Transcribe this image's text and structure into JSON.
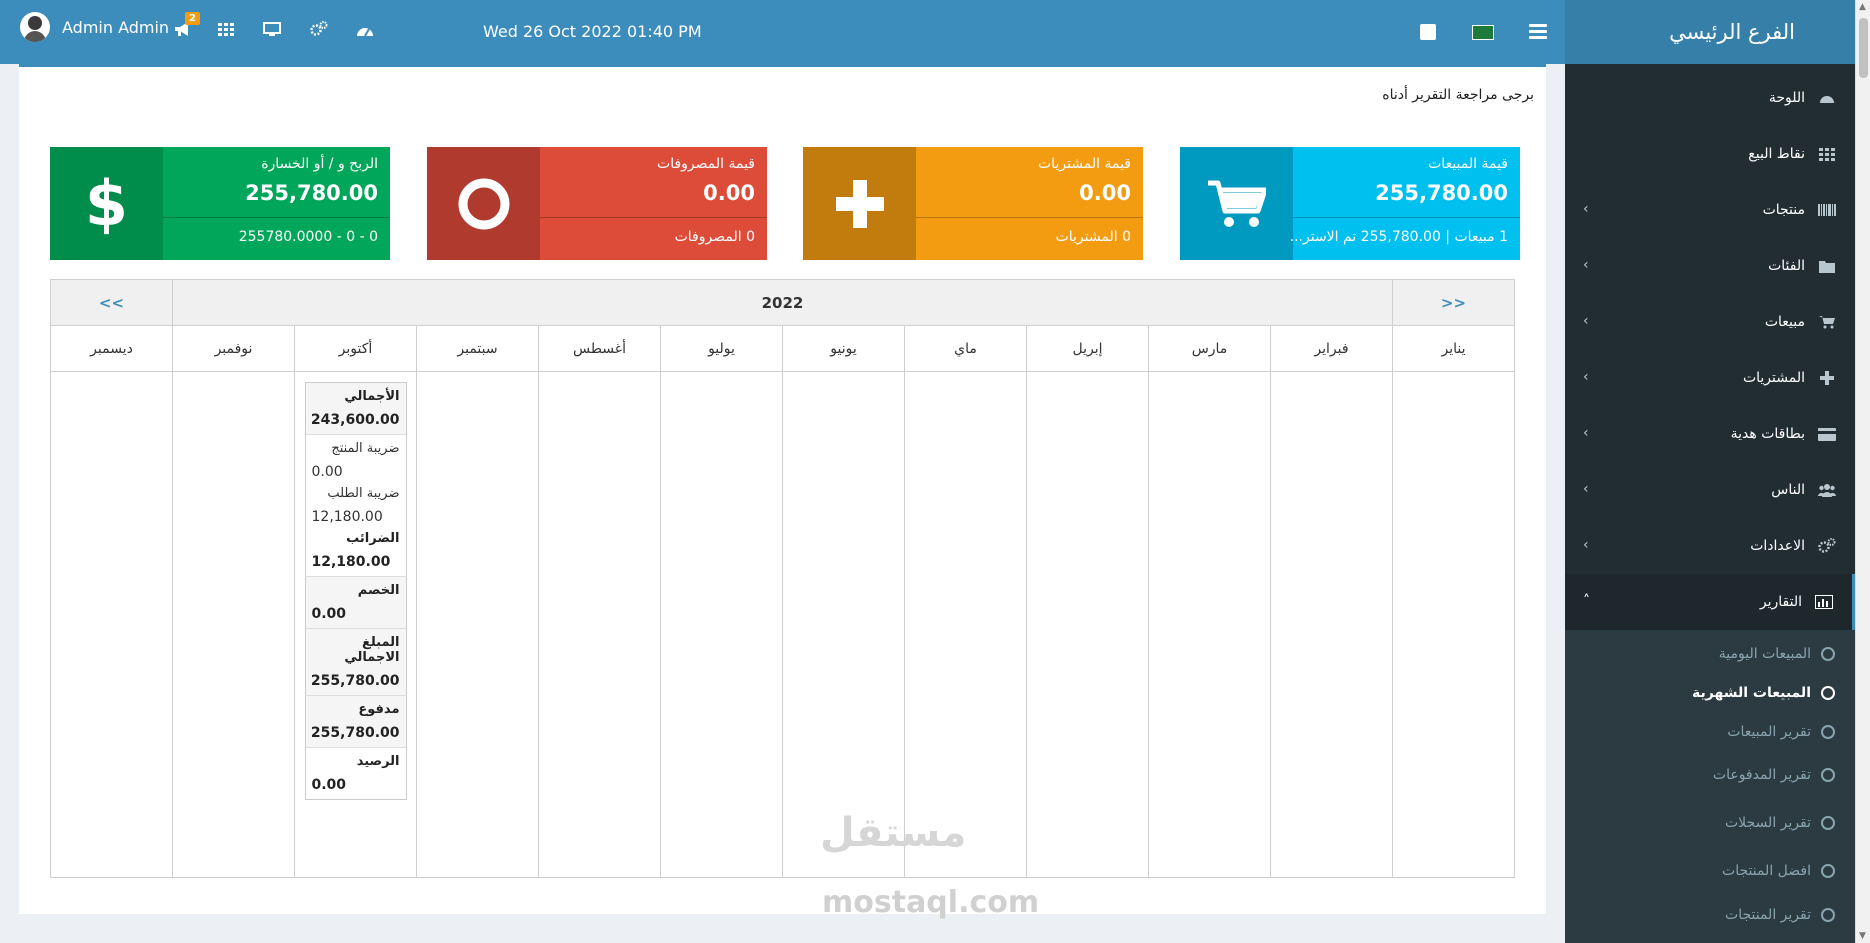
{
  "header": {
    "user_name": "Admin Admin",
    "notification_count": "2",
    "datetime": "Wed 26 Oct 2022 01:40 PM"
  },
  "sidebar": {
    "brand": "الفرع الرئيسي",
    "items": [
      {
        "label": "اللوحة",
        "icon": "dashboard-icon"
      },
      {
        "label": "نقاط البيع",
        "icon": "grid-icon"
      },
      {
        "label": "منتجات",
        "icon": "barcode-icon"
      },
      {
        "label": "الفئات",
        "icon": "folder-icon"
      },
      {
        "label": "مبيعات",
        "icon": "cart-icon"
      },
      {
        "label": "المشتريات",
        "icon": "plus-icon"
      },
      {
        "label": "بطاقات هدية",
        "icon": "credit-card-icon"
      },
      {
        "label": "الناس",
        "icon": "users-icon"
      },
      {
        "label": "الاعدادات",
        "icon": "gears-icon"
      },
      {
        "label": "التقارير",
        "icon": "bar-chart-icon"
      }
    ],
    "sub_items": [
      {
        "label": "المبيعات اليومية"
      },
      {
        "label": "المبيعات الشهرية"
      },
      {
        "label": "تقرير المبيعات"
      },
      {
        "label": "تقرير المدفوعات"
      },
      {
        "label": "تقرير السجلات"
      },
      {
        "label": "افضل المنتجات"
      },
      {
        "label": "تقرير المنتجات"
      }
    ]
  },
  "intro": "برجى مراجعة التقرير أدناه",
  "stats": {
    "sales": {
      "title": "قيمة المبيعات",
      "value": "255,780.00",
      "foot": "1 مبيعات | 255,780.00 تم الاستر...",
      "color": "#00c0ef"
    },
    "purchases": {
      "title": "قيمة المشتريات",
      "value": "0.00",
      "foot": "0 المشتريات",
      "color": "#f39c12"
    },
    "expenses": {
      "title": "قيمة المصروفات",
      "value": "0.00",
      "foot": "0 المصروفات",
      "color": "#dd4b39"
    },
    "profit": {
      "title": "الربح و / أو الخسارة",
      "value": "255,780.00",
      "foot": "0 - 0 - 255780.0000",
      "color": "#00a65a"
    }
  },
  "calendar": {
    "year": "2022",
    "prev": "<<",
    "next": ">>",
    "months": [
      "يناير",
      "فبراير",
      "مارس",
      "إبريل",
      "ماي",
      "يونيو",
      "يوليو",
      "أغسطس",
      "سبتمبر",
      "أكتوبر",
      "نوفمبر",
      "ديسمبر"
    ],
    "october": {
      "total_label": "الأجمالي",
      "total_value": "243,600.00",
      "product_tax_label": "ضريبة المنتج",
      "product_tax_value": "0.00",
      "order_tax_label": "ضريبة الطلب",
      "order_tax_value": "12,180.00",
      "taxes_label": "الضرائب",
      "taxes_value": "12,180.00",
      "discount_label": "الخصم",
      "discount_value": "0.00",
      "grand_total_label": "المبلغ الاجمالي",
      "grand_total_value": "255,780.00",
      "paid_label": "مدفوع",
      "paid_value": "255,780.00",
      "balance_label": "الرصيد",
      "balance_value": "0.00"
    }
  },
  "watermark": {
    "arabic": "مستقل",
    "latin": "mostaql.com"
  }
}
